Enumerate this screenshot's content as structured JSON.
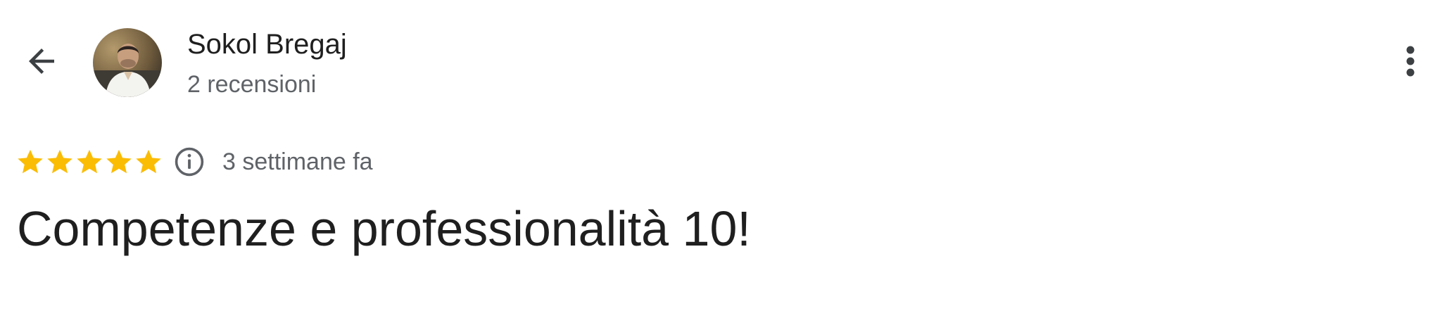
{
  "header": {
    "back_icon": "arrow-back-icon",
    "more_icon": "more-vert-icon"
  },
  "reviewer": {
    "name": "Sokol Bregaj",
    "reviews_count": "2 recensioni",
    "avatar_icon": "avatar-photo"
  },
  "review": {
    "rating": 5,
    "rating_max": 5,
    "star_color": "#fbbc04",
    "info_icon": "info-icon",
    "time": "3 settimane fa",
    "text": "Competenze e professionalità 10!"
  }
}
